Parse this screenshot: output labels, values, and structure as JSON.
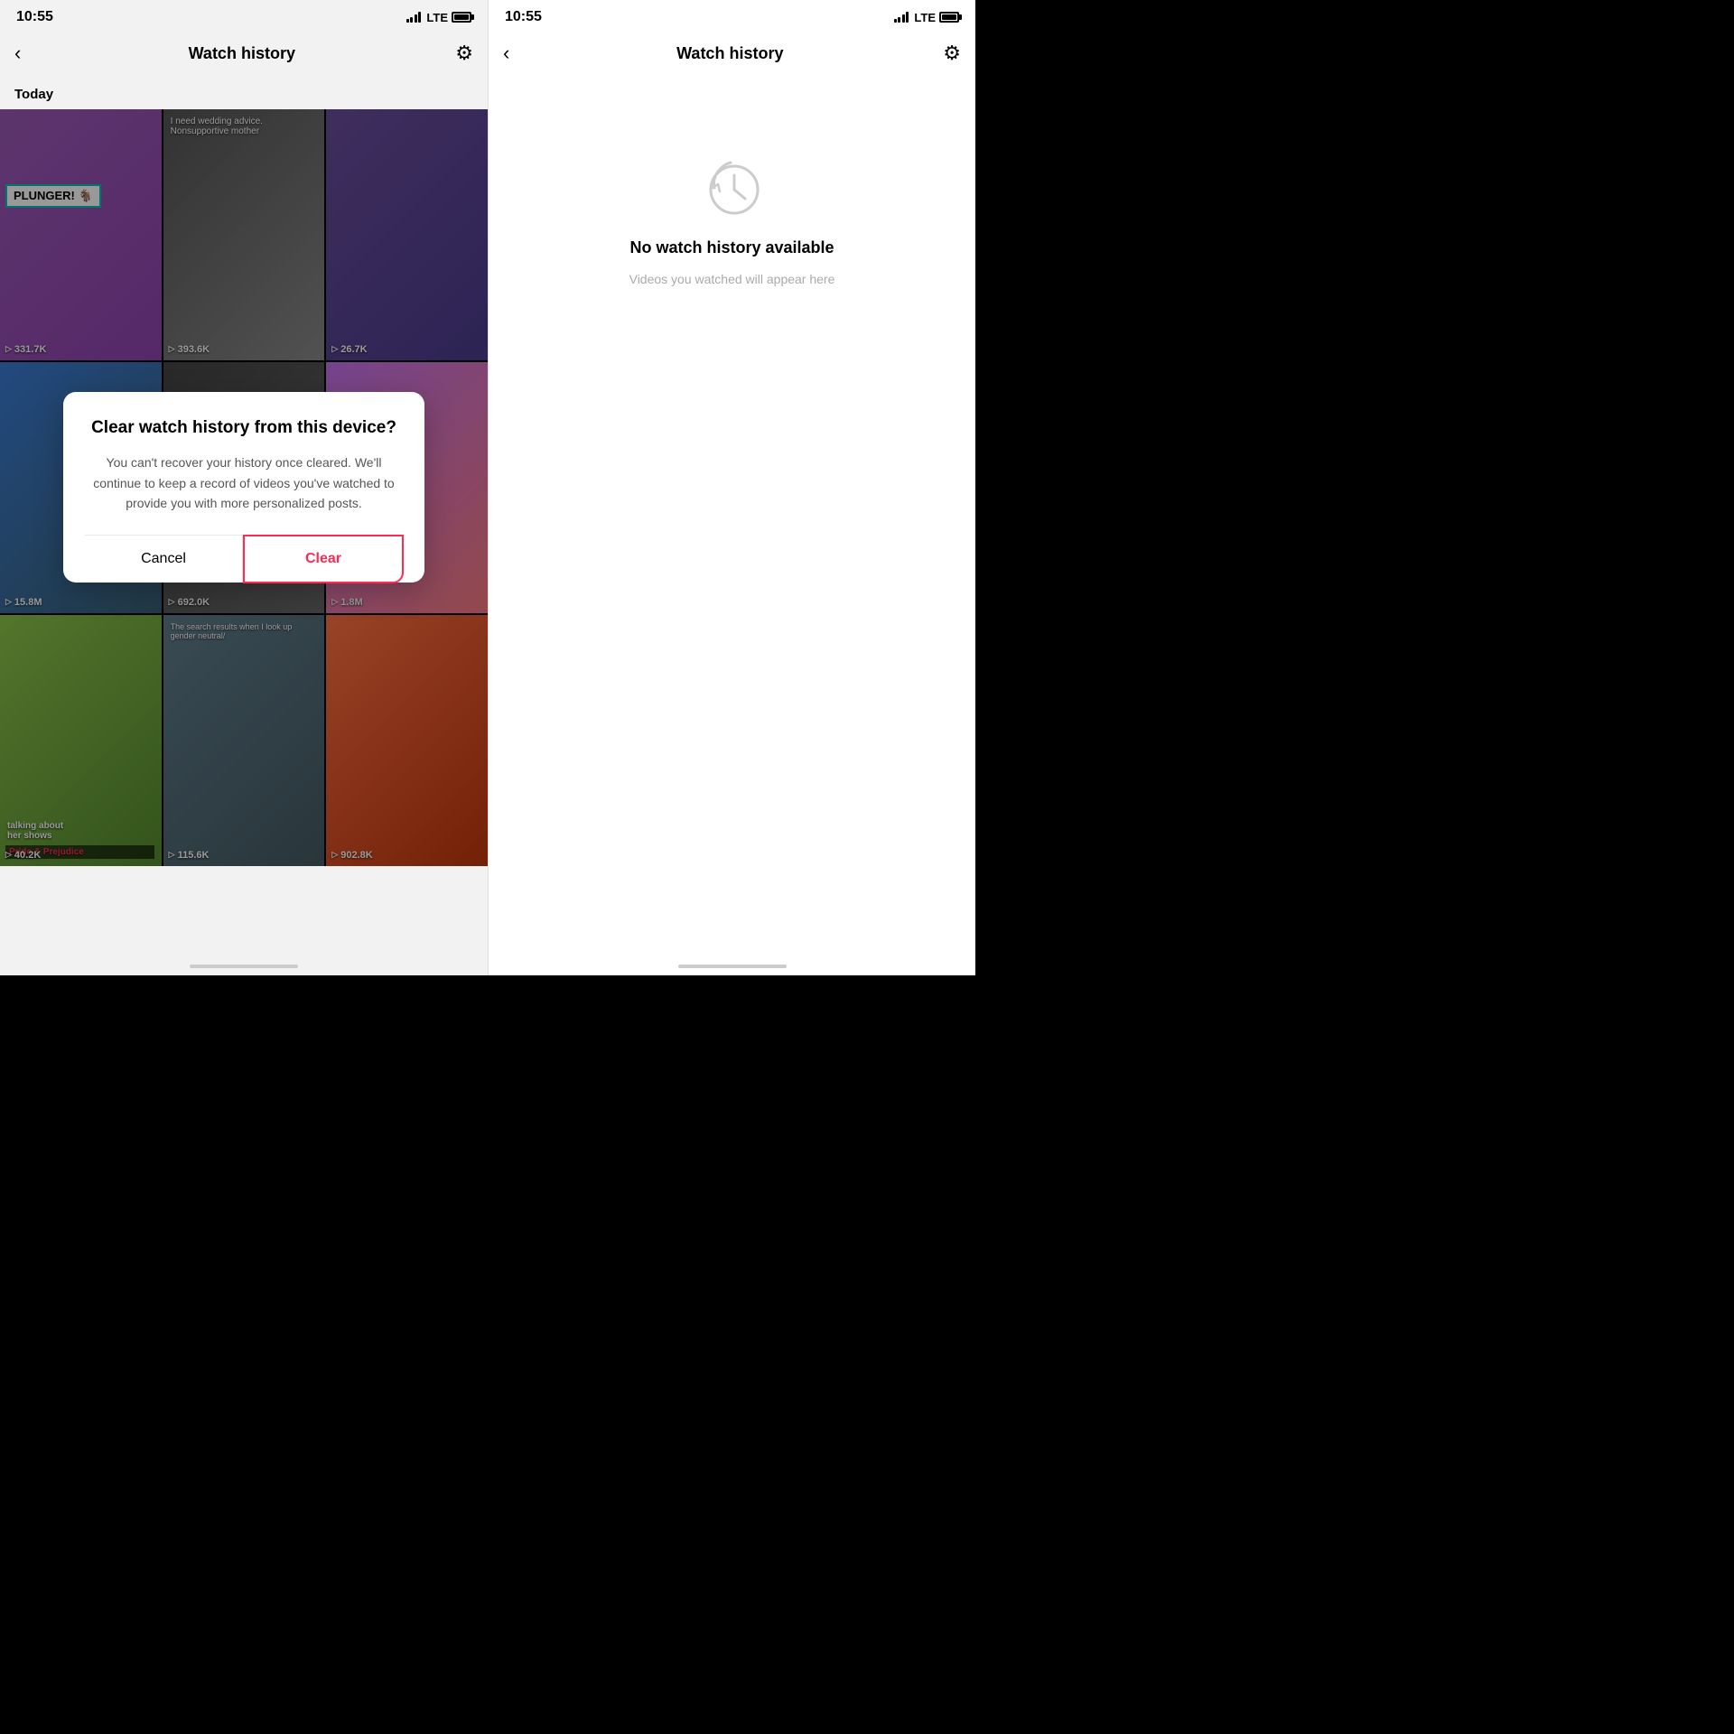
{
  "left": {
    "status": {
      "time": "10:55",
      "lte": "LTE"
    },
    "nav": {
      "back": "‹",
      "title": "Watch history",
      "gear": "⚙"
    },
    "section": "Today",
    "videos": [
      {
        "id": 1,
        "color": "t1",
        "views": "331.7K",
        "hasBadge": true,
        "badgeText": "PLUNGER! 🐐",
        "textOverlay": ""
      },
      {
        "id": 2,
        "color": "t2",
        "views": "393.6K",
        "hasBadge": false,
        "textOverlay": "I need wedding advice. Nonsupportive mother"
      },
      {
        "id": 3,
        "color": "t3",
        "views": "26.7K",
        "hasBadge": false,
        "textOverlay": ""
      },
      {
        "id": 4,
        "color": "t4",
        "views": "15.8M",
        "hasBadge": false,
        "textOverlay": ""
      },
      {
        "id": 5,
        "color": "t5",
        "views": "692.0K",
        "hasBadge": false,
        "textOverlay": ""
      },
      {
        "id": 6,
        "color": "t6",
        "views": "1.8M",
        "hasBadge": false,
        "textOverlay": ""
      },
      {
        "id": 7,
        "color": "t7",
        "views": "40.2K",
        "hasBadge": false,
        "textOverlay": "Pride & Prejudice",
        "bottomLabel": "talking about her shows"
      },
      {
        "id": 8,
        "color": "t8",
        "views": "115.6K",
        "hasBadge": false,
        "textOverlay": "The search results when I look up gender neutral/"
      },
      {
        "id": 9,
        "color": "t9",
        "views": "902.8K",
        "hasBadge": false,
        "textOverlay": ""
      }
    ],
    "modal": {
      "title": "Clear watch history from this device?",
      "body": "You can't recover your history once cleared. We'll continue to keep a record of videos you've watched to provide you with more personalized posts.",
      "cancel_label": "Cancel",
      "clear_label": "Clear"
    }
  },
  "right": {
    "status": {
      "time": "10:55",
      "lte": "LTE"
    },
    "nav": {
      "back": "‹",
      "title": "Watch history",
      "gear": "⚙"
    },
    "empty": {
      "title": "No watch history available",
      "subtitle": "Videos you watched will appear here"
    }
  }
}
